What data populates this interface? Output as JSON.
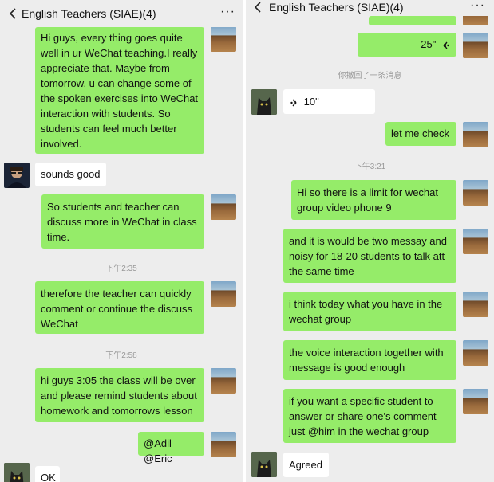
{
  "left": {
    "title": "English Teachers (SIAE)(4)",
    "more": "···",
    "messages": [
      {
        "text": "Hi guys, every thing goes quite well in ur WeChat teaching.I really appreciate that. Maybe from tomorrow, u can change some of the spoken exercises into WeChat interaction with students. So students can feel much better involved."
      },
      {
        "text": "sounds good"
      },
      {
        "text": "So students and teacher can discuss more in WeChat in class time."
      },
      {
        "time": "下午2:35"
      },
      {
        "text": "therefore the teacher can quickly comment or continue the discuss WeChat"
      },
      {
        "time": "下午2:58"
      },
      {
        "text": "hi guys   3:05 the class will be over and please remind students about homework and tomorrows lesson"
      },
      {
        "text": "@Adil @Eric"
      },
      {
        "text": "OK"
      }
    ]
  },
  "right": {
    "title": "English Teachers (SIAE)(4)",
    "more": "···",
    "messages": [
      {
        "voice": "25\""
      },
      {
        "system": "你撤回了一条消息"
      },
      {
        "voice": "10\""
      },
      {
        "text": "let me check"
      },
      {
        "time": "下午3:21"
      },
      {
        "text": "Hi   so there is a limit for wechat group video phone   9"
      },
      {
        "text": "and it is would be two messay and noisy for 18-20 students to talk att the same time"
      },
      {
        "text": "i think today what you have in the wechat group"
      },
      {
        "text": "the voice interaction together with message is good enough"
      },
      {
        "text": "if you want a specific student to answer  or share one's comment just @him in the wechat group"
      },
      {
        "text": "Agreed"
      }
    ]
  },
  "colors": {
    "background": "#ededed",
    "outgoing_bubble": "#95ec69",
    "incoming_bubble": "#ffffff",
    "timestamp": "#999999"
  },
  "icons": {
    "back": "chevron-left-icon",
    "more": "more-icon",
    "voice": "voice-wave-icon"
  }
}
